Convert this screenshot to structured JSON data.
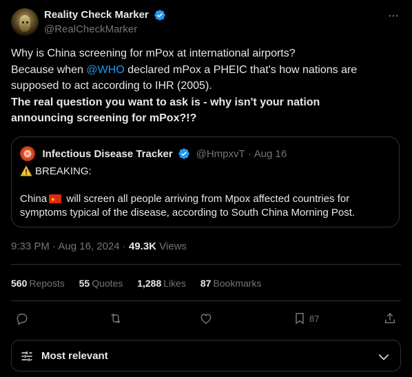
{
  "author": {
    "display_name": "Reality Check Marker",
    "handle": "@RealCheckMarker"
  },
  "tweet": {
    "line1": "Why is China screening for mPox at international airports?",
    "line2_pre": "Because when ",
    "line2_mention": "@WHO",
    "line2_post": " declared mPox a PHEIC that's how nations are",
    "line3": "supposed to act according to IHR (2005).",
    "line4": "The real question you want to ask is - why isn't your nation",
    "line5": "announcing screening for mPox?!?"
  },
  "quote": {
    "display_name": "Infectious Disease Tracker",
    "handle": "@HmpxvT",
    "separator": "·",
    "date": "Aug 16",
    "breaking": "BREAKING:",
    "body_pre_flag": "China",
    "body_post_flag": " will screen all people arriving from Mpox affected countries for",
    "body_line2": "symptoms typical of the disease, according to South China Morning Post."
  },
  "meta": {
    "time": "9:33 PM",
    "separator": "·",
    "date": "Aug 16, 2024",
    "separator2": "·",
    "views_count": "49.3K",
    "views_label": "Views"
  },
  "stats": [
    {
      "num": "560",
      "label": "Reposts"
    },
    {
      "num": "55",
      "label": "Quotes"
    },
    {
      "num": "1,288",
      "label": "Likes"
    },
    {
      "num": "87",
      "label": "Bookmarks"
    }
  ],
  "actions": {
    "bookmark_count": "87"
  },
  "sort": {
    "label": "Most relevant"
  },
  "colors": {
    "background": "#000000",
    "text": "#e7e9ea",
    "secondary": "#71767b",
    "accent": "#1d9bf0",
    "border": "#2f3336"
  },
  "icons": {
    "verified": "verified-badge-icon",
    "more": "more-icon",
    "warning": "warning-icon",
    "flag": "china-flag-icon",
    "reply": "reply-icon",
    "repost": "repost-icon",
    "like": "like-icon",
    "bookmark": "bookmark-icon",
    "share": "share-icon",
    "sort": "sort-filter-icon",
    "chevron": "chevron-down-icon"
  }
}
